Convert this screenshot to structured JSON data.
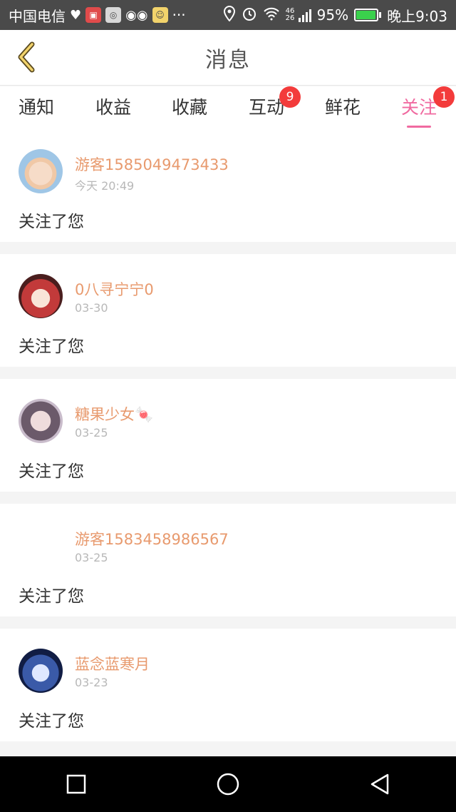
{
  "status_bar": {
    "carrier": "中国电信",
    "signal_label": "46 26",
    "battery": "95%",
    "battery_level": 0.95,
    "time": "晚上9:03"
  },
  "header": {
    "title": "消息",
    "accent_color": "#f06aa0"
  },
  "tabs": [
    {
      "label": "通知",
      "badge": ""
    },
    {
      "label": "收益",
      "badge": ""
    },
    {
      "label": "收藏",
      "badge": ""
    },
    {
      "label": "互动",
      "badge": "9"
    },
    {
      "label": "鲜花",
      "badge": ""
    },
    {
      "label": "关注",
      "badge": "1",
      "active": true
    }
  ],
  "items": [
    {
      "username": "游客1585049473433",
      "time": "今天 20:49",
      "message": "关注了您"
    },
    {
      "username": "0八寻宁宁0",
      "time": "03-30",
      "message": "关注了您"
    },
    {
      "username": "糖果少女🍬",
      "time": "03-25",
      "message": "关注了您"
    },
    {
      "username": "游客1583458986567",
      "time": "03-25",
      "message": "关注了您"
    },
    {
      "username": "蓝念蓝寒月",
      "time": "03-23",
      "message": "关注了您"
    }
  ]
}
